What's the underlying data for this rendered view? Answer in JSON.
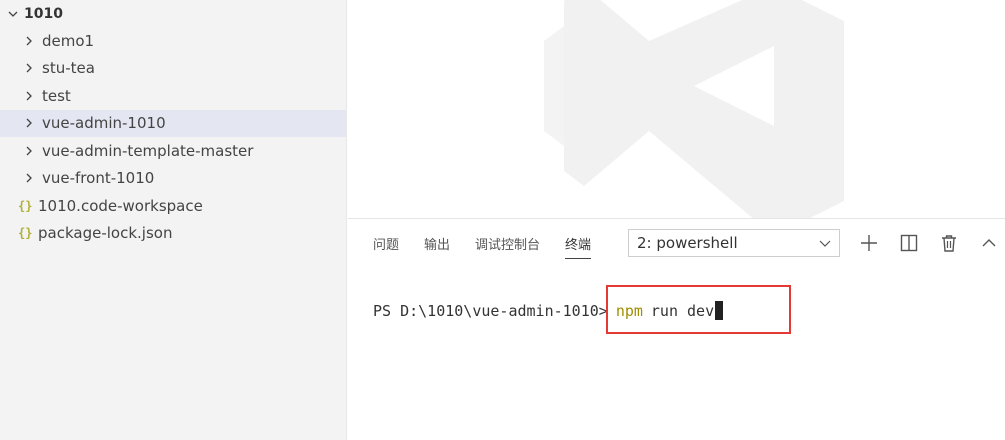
{
  "explorer": {
    "root": "1010",
    "items": [
      {
        "label": "demo1",
        "kind": "folder"
      },
      {
        "label": "stu-tea",
        "kind": "folder"
      },
      {
        "label": "test",
        "kind": "folder"
      },
      {
        "label": "vue-admin-1010",
        "kind": "folder",
        "selected": true
      },
      {
        "label": "vue-admin-template-master",
        "kind": "folder"
      },
      {
        "label": "vue-front-1010",
        "kind": "folder"
      },
      {
        "label": "1010.code-workspace",
        "kind": "json"
      },
      {
        "label": "package-lock.json",
        "kind": "json"
      }
    ],
    "json_icon_glyph": "{}"
  },
  "panel": {
    "tabs": [
      "问题",
      "输出",
      "调试控制台",
      "终端"
    ],
    "active_tab": "终端",
    "terminal_select": "2: powershell",
    "actions": [
      "plus-icon",
      "split-icon",
      "trash-icon",
      "chevron-up-icon"
    ]
  },
  "terminal": {
    "prompt": "PS D:\\1010\\vue-admin-1010>",
    "cmd_keyword": "npm",
    "cmd_args": "run dev"
  },
  "colors": {
    "sidebar_bg": "#f3f3f3",
    "selected_bg": "#e4e6f1",
    "highlight_border": "#e53935",
    "npm_color": "#a08d00"
  }
}
